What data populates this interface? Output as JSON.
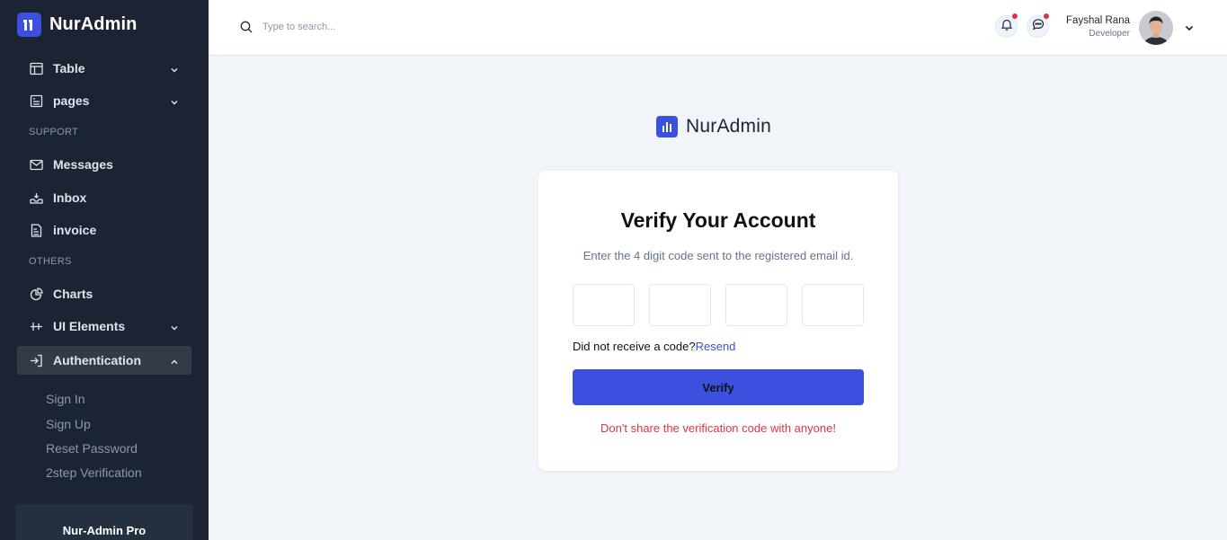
{
  "brand": {
    "name": "NurAdmin"
  },
  "sidebar": {
    "items": [
      {
        "label": "Table",
        "icon": "table-icon",
        "has_chevron": true
      },
      {
        "label": "pages",
        "icon": "pages-icon",
        "has_chevron": true
      },
      {
        "label": "Messages",
        "icon": "mail-icon"
      },
      {
        "label": "Inbox",
        "icon": "inbox-icon"
      },
      {
        "label": "invoice",
        "icon": "invoice-icon"
      },
      {
        "label": "Charts",
        "icon": "pie-chart-icon"
      },
      {
        "label": "UI Elements",
        "icon": "sliders-icon",
        "has_chevron": true
      },
      {
        "label": "Authentication",
        "icon": "login-icon",
        "has_chevron": true,
        "expanded": true
      }
    ],
    "sections": {
      "support": "SUPPORT",
      "others": "OTHERS"
    },
    "auth_subitems": [
      "Sign In",
      "Sign Up",
      "Reset Password",
      "2step Verification"
    ],
    "promo": {
      "title": "Nur-Admin Pro"
    }
  },
  "header": {
    "search": {
      "placeholder": "Type to search..."
    },
    "user": {
      "name": "Fayshal Rana",
      "role": "Developer"
    },
    "notification_dot_color": "#dc3545"
  },
  "main": {
    "logo_text": "NurAdmin",
    "card": {
      "title": "Verify Your Account",
      "subtitle": "Enter the 4 digit code sent to the registered email id.",
      "code_digits": [
        "",
        "",
        "",
        ""
      ],
      "resend_prompt": "Did not receive a code?",
      "resend_link": "Resend",
      "verify_label": "Verify",
      "warning": "Don't share the verification code with anyone!"
    }
  },
  "colors": {
    "sidebar_bg": "#1c2434",
    "accent": "#3c50e0",
    "warning": "#dc3545",
    "page_bg": "#f1f5f9"
  }
}
